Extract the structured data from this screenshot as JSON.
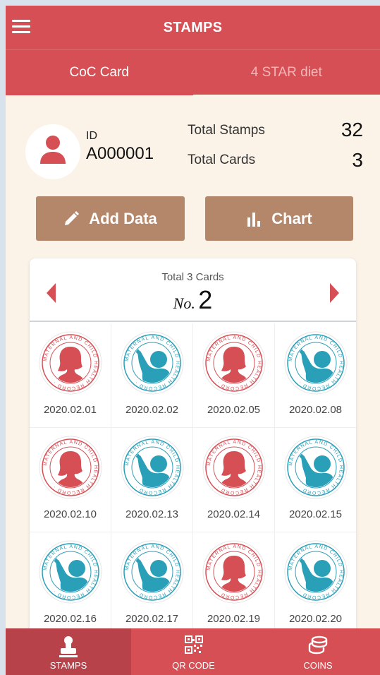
{
  "header": {
    "title": "STAMPS",
    "menu_icon": "hamburger-menu-icon"
  },
  "tabs": [
    {
      "label": "CoC Card",
      "active": true
    },
    {
      "label": "4 STAR diet",
      "active": false
    }
  ],
  "profile": {
    "avatar_icon": "user-icon",
    "id_label": "ID",
    "id_value": "A000001",
    "total_stamps_label": "Total Stamps",
    "total_stamps_value": "32",
    "total_cards_label": "Total Cards",
    "total_cards_value": "3"
  },
  "actions": {
    "add_label": "Add Data",
    "add_icon": "pencil-icon",
    "chart_label": "Chart",
    "chart_icon": "bar-chart-icon"
  },
  "card": {
    "total_text": "Total 3 Cards",
    "no_prefix": "No.",
    "no_value": "2",
    "stamp_text": "MATERNAL AND CHILD HEALTH RECORD",
    "stamps": [
      {
        "date": "2020.02.01",
        "type": "mother",
        "color": "#d64f55"
      },
      {
        "date": "2020.02.02",
        "type": "baby",
        "color": "#2a9fb8"
      },
      {
        "date": "2020.02.05",
        "type": "mother",
        "color": "#d64f55"
      },
      {
        "date": "2020.02.08",
        "type": "baby",
        "color": "#2a9fb8"
      },
      {
        "date": "2020.02.10",
        "type": "mother",
        "color": "#d64f55"
      },
      {
        "date": "2020.02.13",
        "type": "baby",
        "color": "#2a9fb8"
      },
      {
        "date": "2020.02.14",
        "type": "mother",
        "color": "#d64f55"
      },
      {
        "date": "2020.02.15",
        "type": "baby",
        "color": "#2a9fb8"
      },
      {
        "date": "2020.02.16",
        "type": "baby",
        "color": "#2a9fb8"
      },
      {
        "date": "2020.02.17",
        "type": "baby",
        "color": "#2a9fb8"
      },
      {
        "date": "2020.02.19",
        "type": "mother",
        "color": "#d64f55"
      },
      {
        "date": "2020.02.20",
        "type": "baby",
        "color": "#2a9fb8"
      }
    ]
  },
  "bottom_nav": [
    {
      "label": "STAMPS",
      "icon": "stamp-icon",
      "active": true
    },
    {
      "label": "QR CODE",
      "icon": "qr-code-icon",
      "active": false
    },
    {
      "label": "COINS",
      "icon": "coins-icon",
      "active": false
    }
  ],
  "colors": {
    "primary": "#d64f55",
    "accent_brown": "#b4876b",
    "background": "#fbf3e8",
    "teal": "#2a9fb8"
  }
}
